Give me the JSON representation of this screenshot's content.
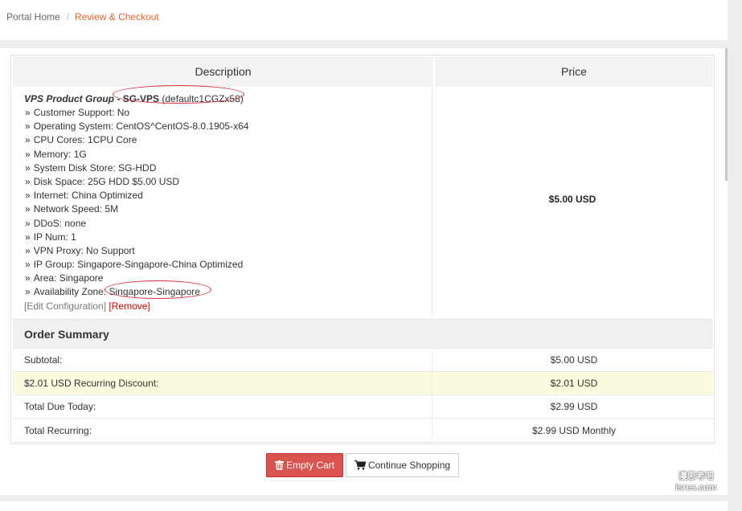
{
  "breadcrumb": {
    "home": "Portal Home",
    "separator": "/",
    "current": "Review & Checkout"
  },
  "table": {
    "headers": {
      "description": "Description",
      "price": "Price"
    }
  },
  "product": {
    "group": "VPS Product Group",
    "dash": " - ",
    "name": "SG-VPS",
    "hostname": "(defaultc1CGZx58)",
    "options": [
      "Customer Support: No",
      "Operating System: CentOS^CentOS-8.0.1905-x64",
      "CPU Cores: 1CPU Core",
      "Memory: 1G",
      "System Disk Store: SG-HDD",
      "Disk Space: 25G HDD $5.00 USD",
      "Internet: China Optimized",
      "Network Speed: 5M",
      "DDoS: none",
      "IP Num: 1",
      "VPN Proxy: No Support",
      "IP Group: Singapore-Singapore-China Optimized",
      "Area: Singapore"
    ],
    "availability_label": "Availability Zone: ",
    "availability_value": "Singapore-Singapore",
    "raquo": "»",
    "edit_label": "[Edit Configuration]",
    "remove_label": "[Remove]",
    "price": "$5.00 USD"
  },
  "summary": {
    "title": "Order Summary",
    "rows": [
      {
        "label": "Subtotal:",
        "value": "$5.00 USD"
      },
      {
        "label": "$2.01 USD Recurring Discount:",
        "value": "$2.01 USD"
      },
      {
        "label": "Total Due Today:",
        "value": "$2.99 USD"
      },
      {
        "label": "Total Recurring:",
        "value": "$2.99 USD Monthly"
      }
    ]
  },
  "buttons": {
    "empty_cart": "Empty Cart",
    "continue_shopping": "Continue Shopping"
  },
  "watermark": {
    "line1": "漫思考吧",
    "line2": "isres.com"
  },
  "colors": {
    "accent": "#e8652a",
    "danger": "#d9534f",
    "discount_bg": "#fcfbdf",
    "annotation": "#d8303a"
  }
}
